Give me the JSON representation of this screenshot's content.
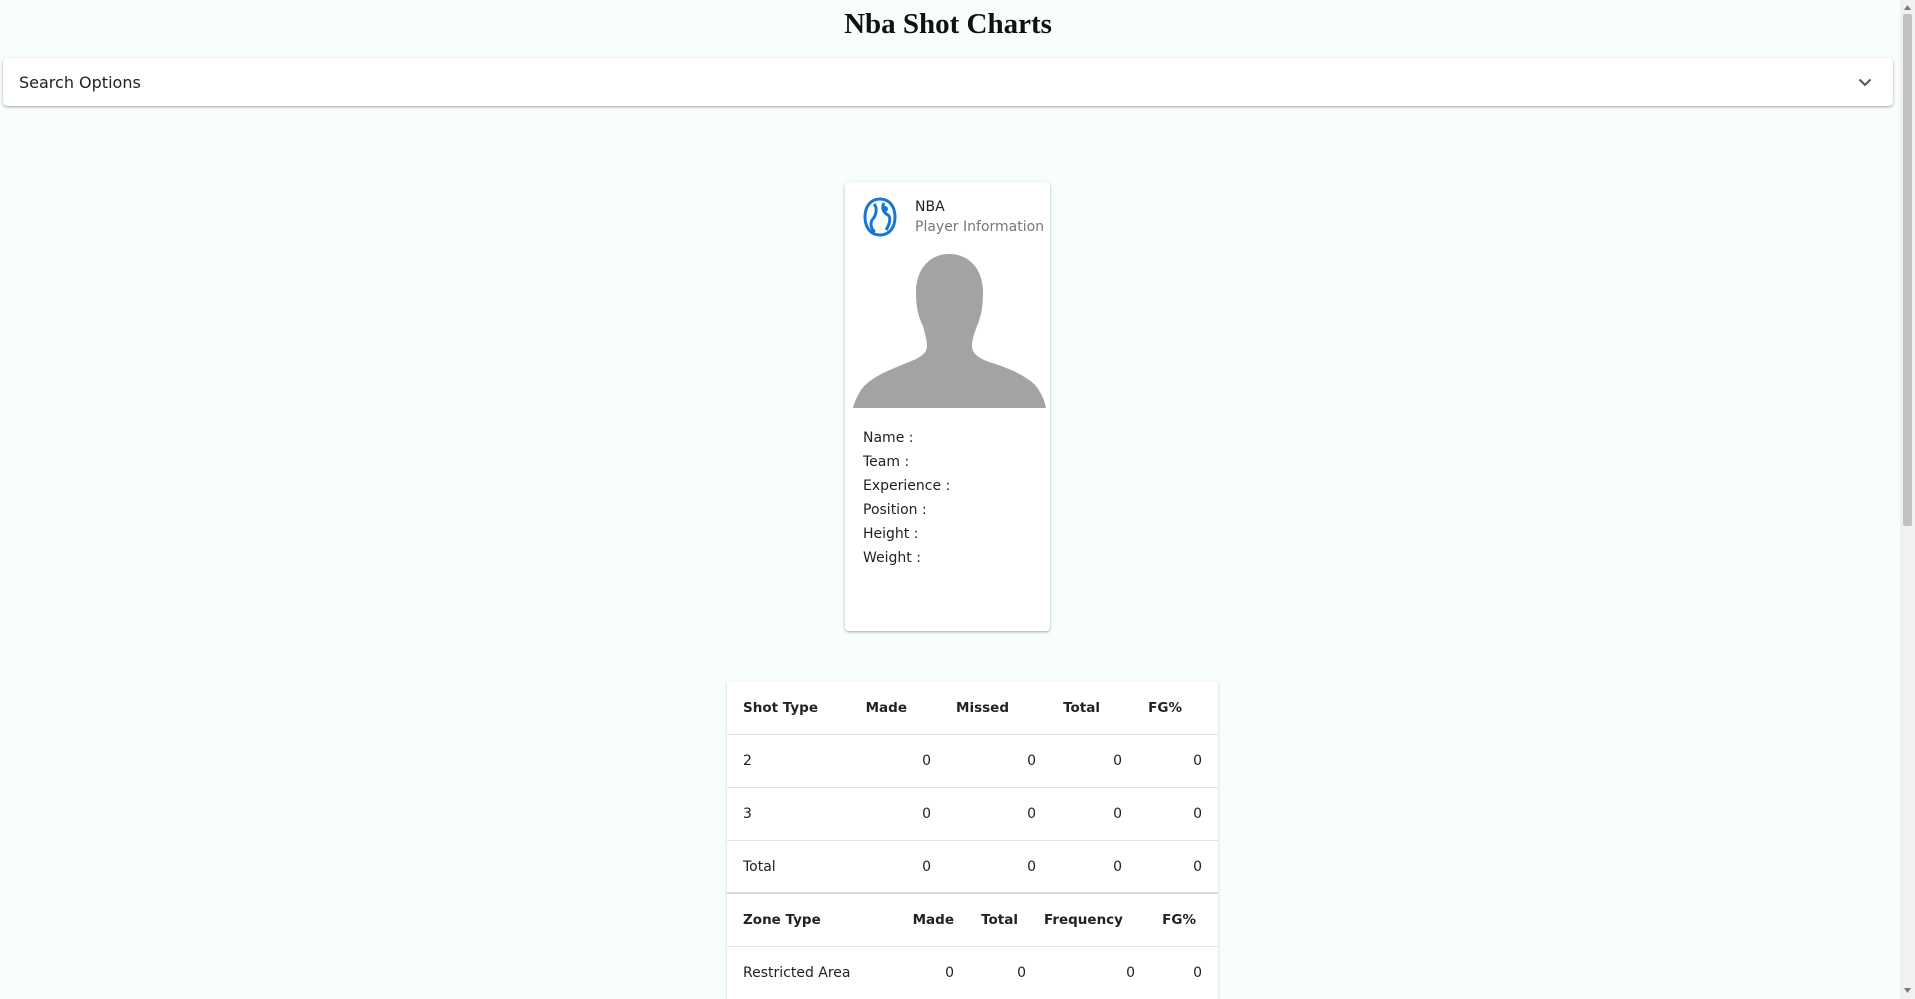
{
  "page": {
    "title": "Nba Shot Charts"
  },
  "search": {
    "label": "Search Options",
    "icon": "chevron-down-icon"
  },
  "player_card": {
    "org": "NBA",
    "subtitle": "Player Information",
    "logo_icon": "nba-logo-icon",
    "avatar_icon": "player-silhouette-icon",
    "fields": {
      "name": "Name :",
      "team": "Team :",
      "experience": "Experience :",
      "position": "Position :",
      "height": "Height :",
      "weight": "Weight :"
    }
  },
  "shot_table": {
    "headers": [
      "Shot Type",
      "Made",
      "Missed",
      "Total",
      "FG%"
    ],
    "rows": [
      [
        "2",
        "0",
        "0",
        "0",
        "0"
      ],
      [
        "3",
        "0",
        "0",
        "0",
        "0"
      ],
      [
        "Total",
        "0",
        "0",
        "0",
        "0"
      ]
    ]
  },
  "zone_table": {
    "headers": [
      "Zone Type",
      "Made",
      "Total",
      "Frequency",
      "FG%"
    ],
    "rows": [
      [
        "Restricted Area",
        "0",
        "0",
        "0",
        "0"
      ]
    ]
  },
  "colors": {
    "background": "#f8fdfd",
    "logo_blue": "#1976d2",
    "silhouette": "#a3a3a3"
  }
}
